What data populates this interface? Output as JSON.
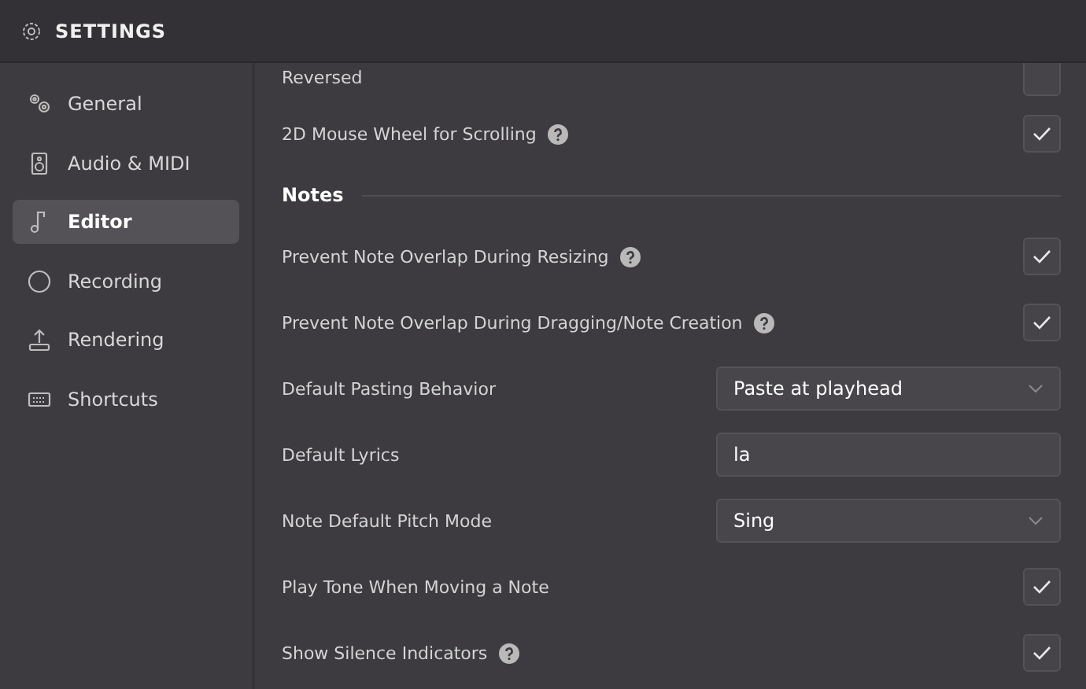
{
  "window": {
    "title": "SETTINGS"
  },
  "sidebar": {
    "items": [
      {
        "label": "General",
        "selected": false
      },
      {
        "label": "Audio & MIDI",
        "selected": false
      },
      {
        "label": "Editor",
        "selected": true
      },
      {
        "label": "Recording",
        "selected": false
      },
      {
        "label": "Rendering",
        "selected": false
      },
      {
        "label": "Shortcuts",
        "selected": false
      }
    ]
  },
  "rows": [
    {
      "kind": "checkbox",
      "label": "Reversed",
      "help": false,
      "checked": false
    },
    {
      "kind": "checkbox",
      "label": "2D Mouse Wheel for Scrolling",
      "help": true,
      "checked": true
    },
    {
      "kind": "section",
      "label": "Notes"
    },
    {
      "kind": "checkbox",
      "label": "Prevent Note Overlap During Resizing",
      "help": true,
      "checked": true
    },
    {
      "kind": "checkbox",
      "label": "Prevent Note Overlap During Dragging/Note Creation",
      "help": true,
      "checked": true
    },
    {
      "kind": "select",
      "label": "Default Pasting Behavior",
      "value": "Paste at playhead"
    },
    {
      "kind": "text",
      "label": "Default Lyrics",
      "value": "la"
    },
    {
      "kind": "select",
      "label": "Note Default Pitch Mode",
      "value": "Sing"
    },
    {
      "kind": "checkbox",
      "label": "Play Tone When Moving a Note",
      "help": false,
      "checked": true
    },
    {
      "kind": "checkbox",
      "label": "Show Silence Indicators",
      "help": true,
      "checked": true
    }
  ]
}
